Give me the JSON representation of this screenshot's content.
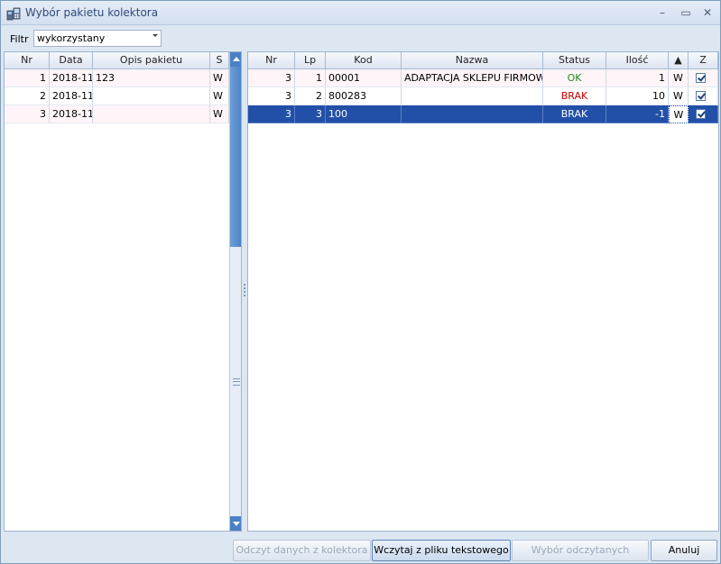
{
  "window": {
    "title": "Wybór pakietu kolektora",
    "controls": {
      "minimize": "–",
      "maximize": "▭",
      "close": "✕"
    }
  },
  "filter": {
    "label": "Filtr",
    "value": "wykorzystany"
  },
  "left_grid": {
    "columns": [
      "Nr",
      "Data",
      "Opis pakietu",
      "S"
    ],
    "rows": [
      {
        "nr": "1",
        "data": "2018-11-",
        "opis": "123",
        "s": "W"
      },
      {
        "nr": "2",
        "data": "2018-11-",
        "opis": "",
        "s": "W"
      },
      {
        "nr": "3",
        "data": "2018-11-",
        "opis": "",
        "s": "W"
      }
    ]
  },
  "right_grid": {
    "columns": [
      "Nr",
      "Lp",
      "Kod",
      "Nazwa",
      "Status",
      "Ilość",
      "▲",
      "Z"
    ],
    "rows": [
      {
        "nr": "3",
        "lp": "1",
        "kod": "00001",
        "nazwa": "ADAPTACJA SKLEPU FIRMOW",
        "status": "OK",
        "ilosc": "1",
        "w": "W"
      },
      {
        "nr": "3",
        "lp": "2",
        "kod": "800283",
        "nazwa": "",
        "status": "BRAK",
        "ilosc": "10",
        "w": "W"
      },
      {
        "nr": "3",
        "lp": "3",
        "kod": "100",
        "nazwa": "",
        "status": "BRAK",
        "ilosc": "-1",
        "w": "W"
      }
    ]
  },
  "colors": {
    "status_ok": "#1a8a1a",
    "status_brak": "#c00000",
    "selection": "#2250a8",
    "zebra": "#fff5f8"
  },
  "footer": {
    "read_collector": "Odczyt danych z kolektora",
    "load_text_file": "Wczytaj z pliku tekstowego",
    "select_read_packages": "Wybór odczytanych pakietów",
    "cancel": "Anuluj"
  }
}
